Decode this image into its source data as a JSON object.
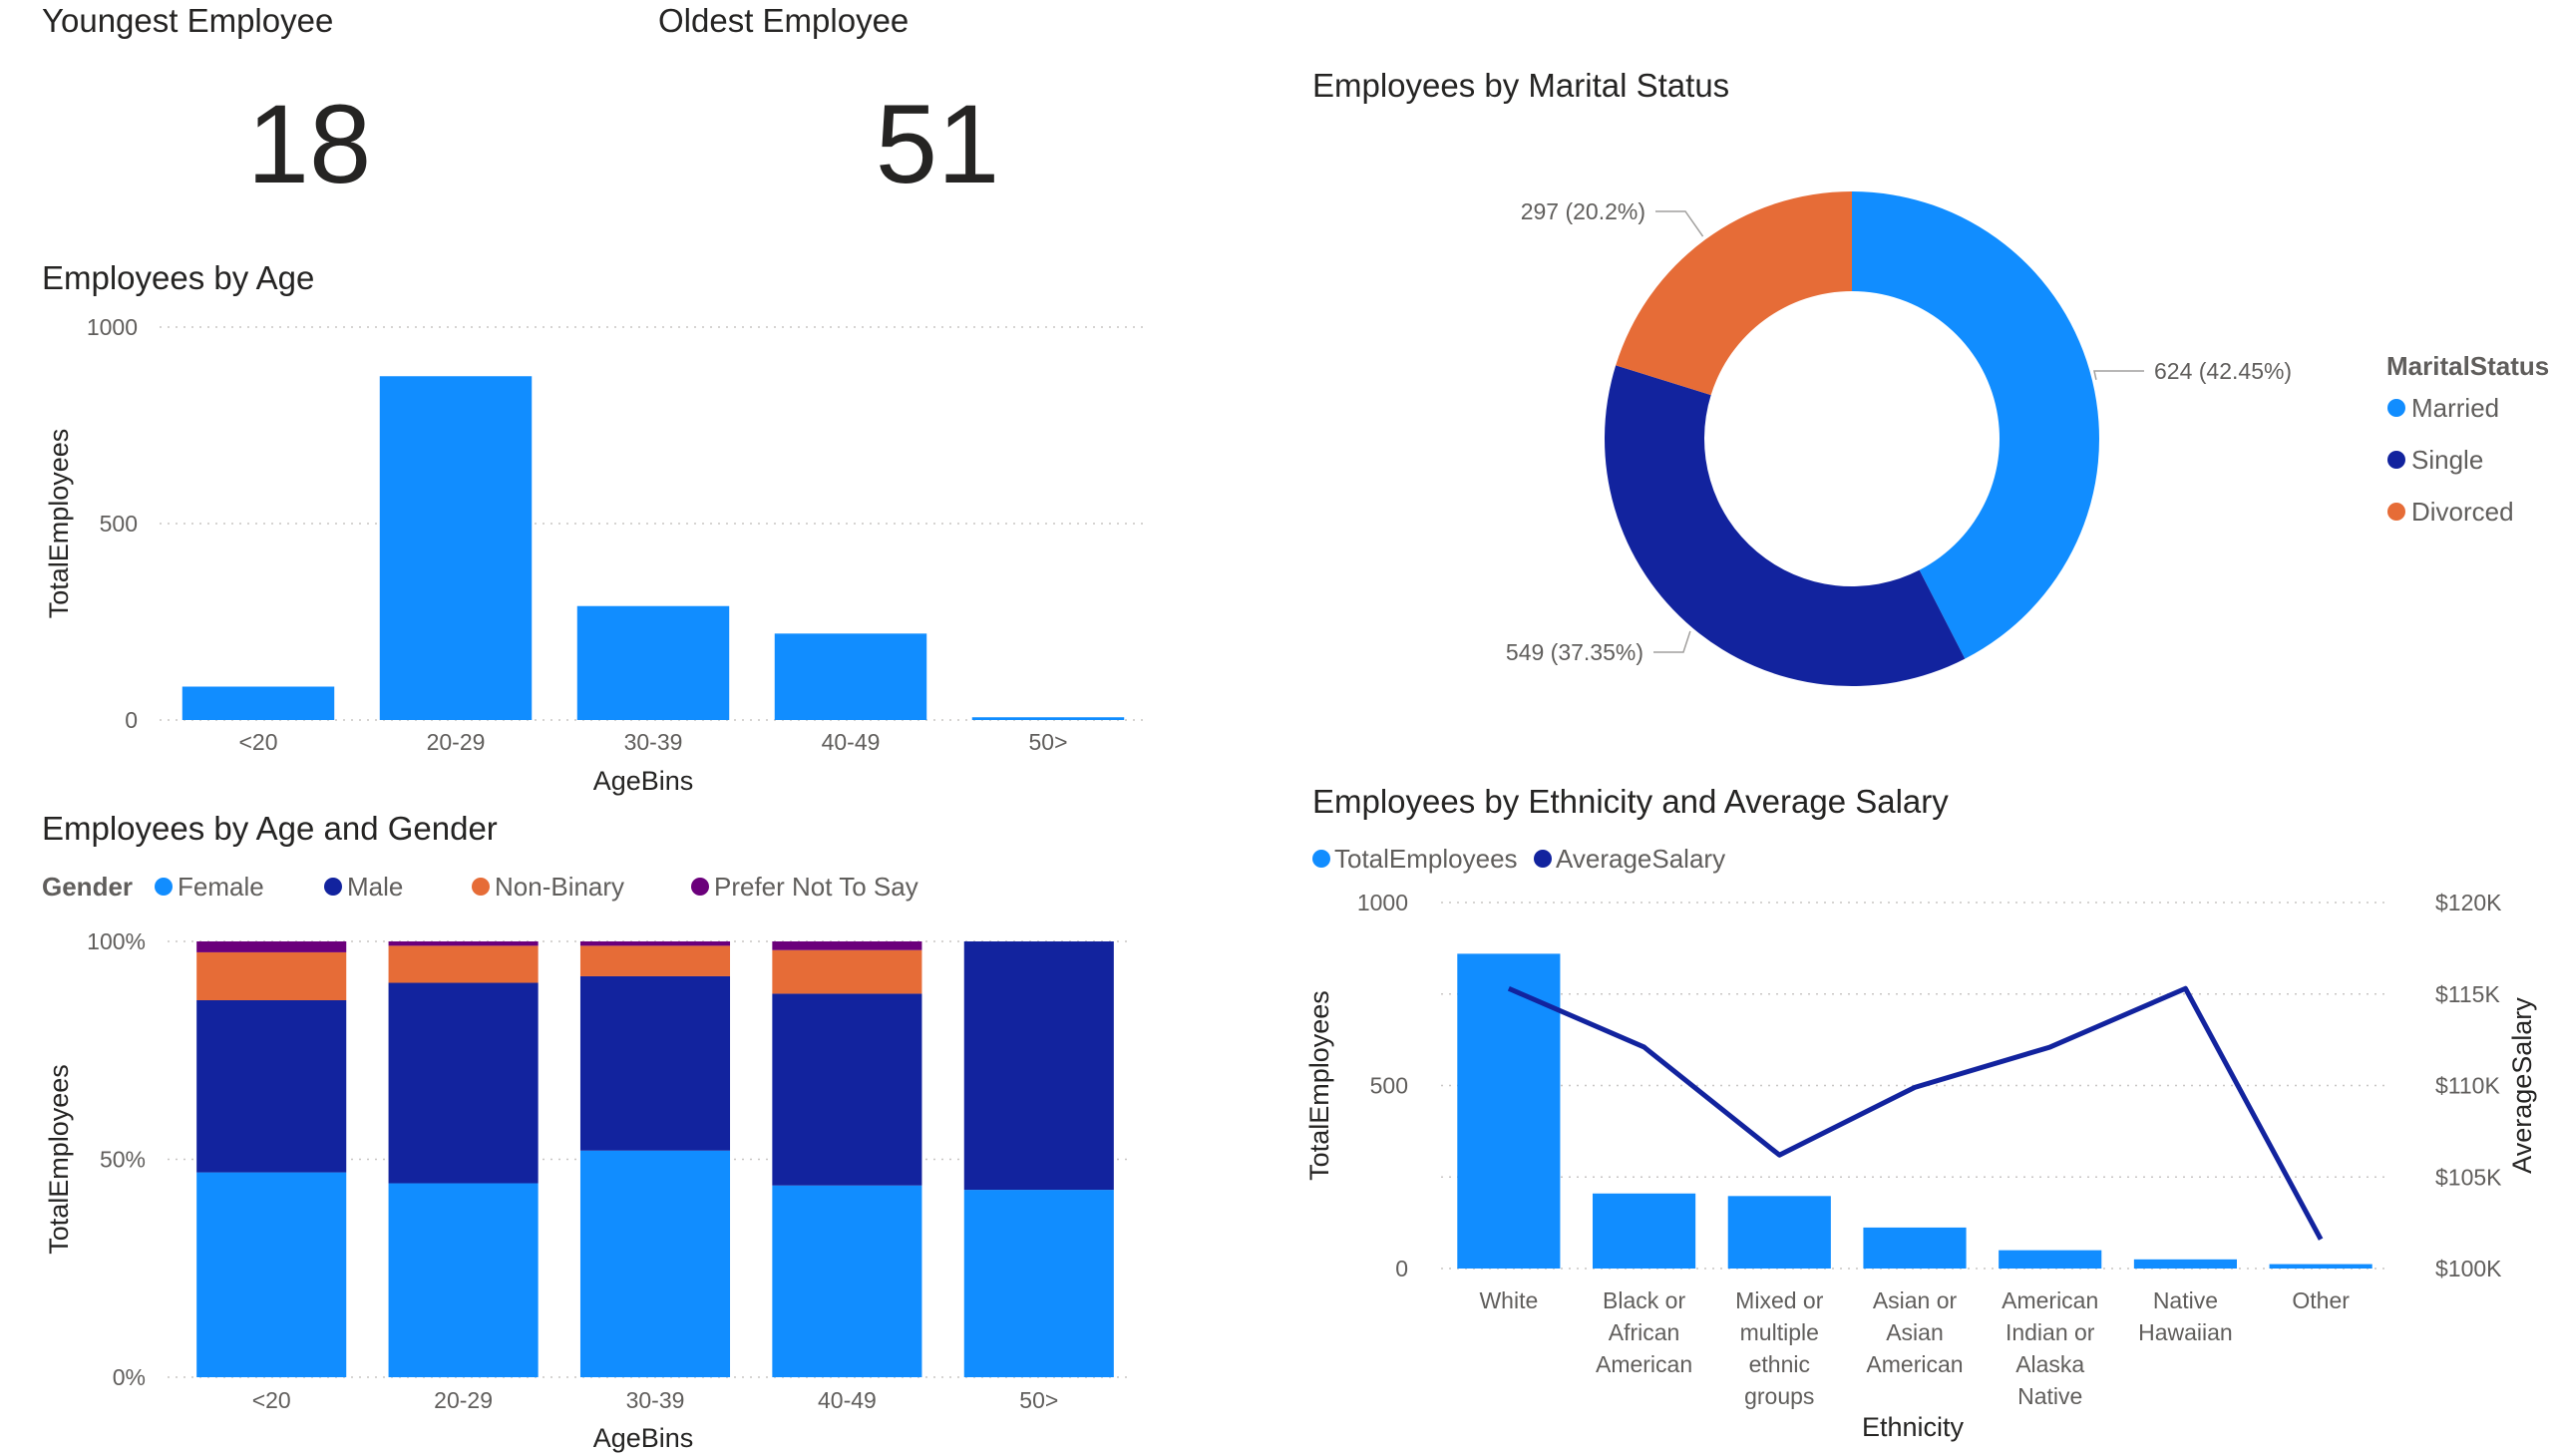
{
  "cards": {
    "youngest": {
      "title": "Youngest Employee",
      "value": "18"
    },
    "oldest": {
      "title": "Oldest Employee",
      "value": "51"
    }
  },
  "colors": {
    "female": "#118DFF",
    "male": "#12239E",
    "nonbinary": "#E66C37",
    "prefer_not": "#6B007B",
    "married": "#118DFF",
    "single": "#12239E",
    "divorced": "#E66C37",
    "bar": "#118DFF",
    "line": "#12239E"
  },
  "chart_data": [
    {
      "id": "age",
      "type": "bar",
      "title": "Employees by Age",
      "xlabel": "AgeBins",
      "ylabel": "TotalEmployees",
      "categories": [
        "<20",
        "20-29",
        "30-39",
        "40-49",
        "50>"
      ],
      "values": [
        85,
        875,
        290,
        220,
        7
      ],
      "ylim": [
        0,
        1000
      ],
      "yticks": [
        "0",
        "500",
        "1000"
      ],
      "grid": true
    },
    {
      "id": "gender",
      "type": "bar",
      "stacked": "100%",
      "title": "Employees by Age and Gender",
      "xlabel": "AgeBins",
      "ylabel": "TotalEmployees",
      "legend_title": "Gender",
      "legend_position": "top-left",
      "categories": [
        "<20",
        "20-29",
        "30-39",
        "40-49",
        "50>"
      ],
      "series": [
        {
          "name": "Female",
          "values": [
            47,
            44.5,
            52,
            44,
            43
          ]
        },
        {
          "name": "Male",
          "values": [
            39.5,
            46,
            40,
            44,
            57
          ]
        },
        {
          "name": "Non-Binary",
          "values": [
            11,
            8.5,
            7,
            10,
            0
          ]
        },
        {
          "name": "Prefer Not To Say",
          "values": [
            2.5,
            1,
            1,
            2,
            0
          ]
        }
      ],
      "ylim": [
        0,
        100
      ],
      "yticks": [
        "0%",
        "50%",
        "100%"
      ],
      "grid": true
    },
    {
      "id": "marital",
      "type": "pie",
      "donut": true,
      "title": "Employees by Marital Status",
      "legend_title": "MaritalStatus",
      "legend_position": "right",
      "slices": [
        {
          "name": "Married",
          "value": 624,
          "label": "624 (42.45%)"
        },
        {
          "name": "Single",
          "value": 549,
          "label": "549 (37.35%)"
        },
        {
          "name": "Divorced",
          "value": 297,
          "label": "297 (20.2%)"
        }
      ]
    },
    {
      "id": "ethnicity",
      "type": "bar",
      "combo": "bar+line",
      "title": "Employees by Ethnicity and Average Salary",
      "xlabel": "Ethnicity",
      "ylabel": "TotalEmployees",
      "y2label": "AverageSalary",
      "legend_position": "top-left",
      "categories": [
        [
          "White"
        ],
        [
          "Black or",
          "African",
          "American"
        ],
        [
          "Mixed or",
          "multiple",
          "ethnic",
          "groups"
        ],
        [
          "Asian or",
          "Asian",
          "American"
        ],
        [
          "American",
          "Indian or",
          "Alaska",
          "Native"
        ],
        [
          "Native",
          "Hawaiian"
        ],
        [
          "Other"
        ]
      ],
      "series": [
        {
          "name": "TotalEmployees",
          "kind": "bar",
          "axis": "left",
          "values": [
            860,
            205,
            198,
            112,
            50,
            25,
            12
          ]
        },
        {
          "name": "AverageSalary",
          "kind": "line",
          "axis": "right",
          "values": [
            115300,
            112100,
            106200,
            109900,
            112100,
            115300,
            101600
          ]
        }
      ],
      "ylim": [
        0,
        1000
      ],
      "y2lim": [
        100000,
        120000
      ],
      "yticks": [
        "0",
        "500",
        "1000"
      ],
      "y2ticks": [
        "$100K",
        "$105K",
        "$110K",
        "$115K",
        "$120K"
      ],
      "grid": true
    }
  ]
}
